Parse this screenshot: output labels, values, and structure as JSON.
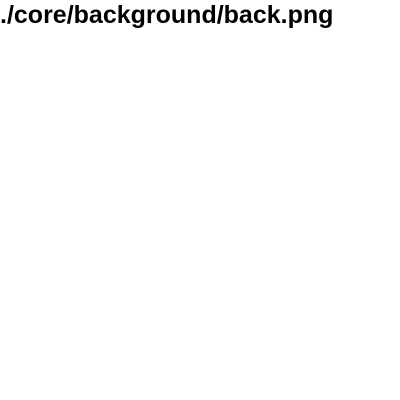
{
  "broken_image": {
    "path_text": "./core/background/back.png"
  }
}
